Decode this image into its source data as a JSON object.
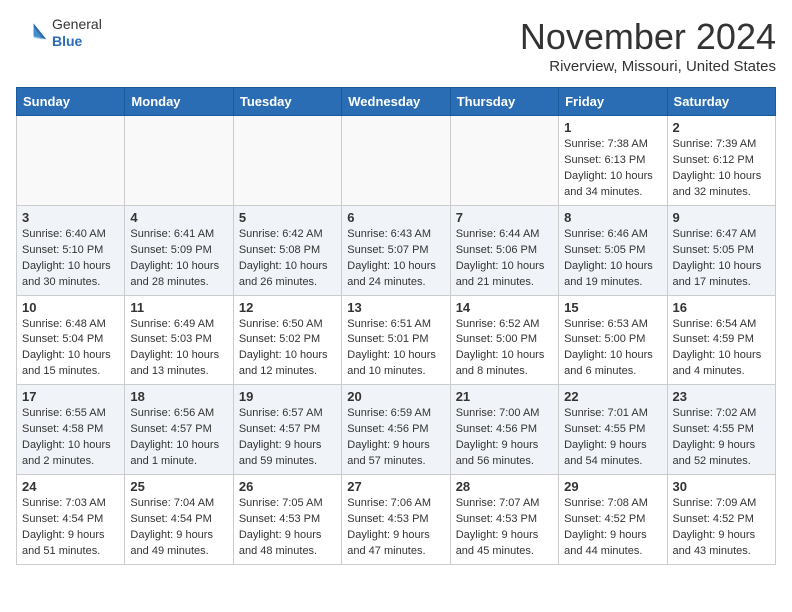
{
  "header": {
    "logo_general": "General",
    "logo_blue": "Blue",
    "month_title": "November 2024",
    "location": "Riverview, Missouri, United States"
  },
  "calendar": {
    "days_of_week": [
      "Sunday",
      "Monday",
      "Tuesday",
      "Wednesday",
      "Thursday",
      "Friday",
      "Saturday"
    ],
    "weeks": [
      [
        {
          "day": "",
          "info": ""
        },
        {
          "day": "",
          "info": ""
        },
        {
          "day": "",
          "info": ""
        },
        {
          "day": "",
          "info": ""
        },
        {
          "day": "",
          "info": ""
        },
        {
          "day": "1",
          "info": "Sunrise: 7:38 AM\nSunset: 6:13 PM\nDaylight: 10 hours\nand 34 minutes."
        },
        {
          "day": "2",
          "info": "Sunrise: 7:39 AM\nSunset: 6:12 PM\nDaylight: 10 hours\nand 32 minutes."
        }
      ],
      [
        {
          "day": "3",
          "info": "Sunrise: 6:40 AM\nSunset: 5:10 PM\nDaylight: 10 hours\nand 30 minutes."
        },
        {
          "day": "4",
          "info": "Sunrise: 6:41 AM\nSunset: 5:09 PM\nDaylight: 10 hours\nand 28 minutes."
        },
        {
          "day": "5",
          "info": "Sunrise: 6:42 AM\nSunset: 5:08 PM\nDaylight: 10 hours\nand 26 minutes."
        },
        {
          "day": "6",
          "info": "Sunrise: 6:43 AM\nSunset: 5:07 PM\nDaylight: 10 hours\nand 24 minutes."
        },
        {
          "day": "7",
          "info": "Sunrise: 6:44 AM\nSunset: 5:06 PM\nDaylight: 10 hours\nand 21 minutes."
        },
        {
          "day": "8",
          "info": "Sunrise: 6:46 AM\nSunset: 5:05 PM\nDaylight: 10 hours\nand 19 minutes."
        },
        {
          "day": "9",
          "info": "Sunrise: 6:47 AM\nSunset: 5:05 PM\nDaylight: 10 hours\nand 17 minutes."
        }
      ],
      [
        {
          "day": "10",
          "info": "Sunrise: 6:48 AM\nSunset: 5:04 PM\nDaylight: 10 hours\nand 15 minutes."
        },
        {
          "day": "11",
          "info": "Sunrise: 6:49 AM\nSunset: 5:03 PM\nDaylight: 10 hours\nand 13 minutes."
        },
        {
          "day": "12",
          "info": "Sunrise: 6:50 AM\nSunset: 5:02 PM\nDaylight: 10 hours\nand 12 minutes."
        },
        {
          "day": "13",
          "info": "Sunrise: 6:51 AM\nSunset: 5:01 PM\nDaylight: 10 hours\nand 10 minutes."
        },
        {
          "day": "14",
          "info": "Sunrise: 6:52 AM\nSunset: 5:00 PM\nDaylight: 10 hours\nand 8 minutes."
        },
        {
          "day": "15",
          "info": "Sunrise: 6:53 AM\nSunset: 5:00 PM\nDaylight: 10 hours\nand 6 minutes."
        },
        {
          "day": "16",
          "info": "Sunrise: 6:54 AM\nSunset: 4:59 PM\nDaylight: 10 hours\nand 4 minutes."
        }
      ],
      [
        {
          "day": "17",
          "info": "Sunrise: 6:55 AM\nSunset: 4:58 PM\nDaylight: 10 hours\nand 2 minutes."
        },
        {
          "day": "18",
          "info": "Sunrise: 6:56 AM\nSunset: 4:57 PM\nDaylight: 10 hours\nand 1 minute."
        },
        {
          "day": "19",
          "info": "Sunrise: 6:57 AM\nSunset: 4:57 PM\nDaylight: 9 hours\nand 59 minutes."
        },
        {
          "day": "20",
          "info": "Sunrise: 6:59 AM\nSunset: 4:56 PM\nDaylight: 9 hours\nand 57 minutes."
        },
        {
          "day": "21",
          "info": "Sunrise: 7:00 AM\nSunset: 4:56 PM\nDaylight: 9 hours\nand 56 minutes."
        },
        {
          "day": "22",
          "info": "Sunrise: 7:01 AM\nSunset: 4:55 PM\nDaylight: 9 hours\nand 54 minutes."
        },
        {
          "day": "23",
          "info": "Sunrise: 7:02 AM\nSunset: 4:55 PM\nDaylight: 9 hours\nand 52 minutes."
        }
      ],
      [
        {
          "day": "24",
          "info": "Sunrise: 7:03 AM\nSunset: 4:54 PM\nDaylight: 9 hours\nand 51 minutes."
        },
        {
          "day": "25",
          "info": "Sunrise: 7:04 AM\nSunset: 4:54 PM\nDaylight: 9 hours\nand 49 minutes."
        },
        {
          "day": "26",
          "info": "Sunrise: 7:05 AM\nSunset: 4:53 PM\nDaylight: 9 hours\nand 48 minutes."
        },
        {
          "day": "27",
          "info": "Sunrise: 7:06 AM\nSunset: 4:53 PM\nDaylight: 9 hours\nand 47 minutes."
        },
        {
          "day": "28",
          "info": "Sunrise: 7:07 AM\nSunset: 4:53 PM\nDaylight: 9 hours\nand 45 minutes."
        },
        {
          "day": "29",
          "info": "Sunrise: 7:08 AM\nSunset: 4:52 PM\nDaylight: 9 hours\nand 44 minutes."
        },
        {
          "day": "30",
          "info": "Sunrise: 7:09 AM\nSunset: 4:52 PM\nDaylight: 9 hours\nand 43 minutes."
        }
      ]
    ]
  }
}
